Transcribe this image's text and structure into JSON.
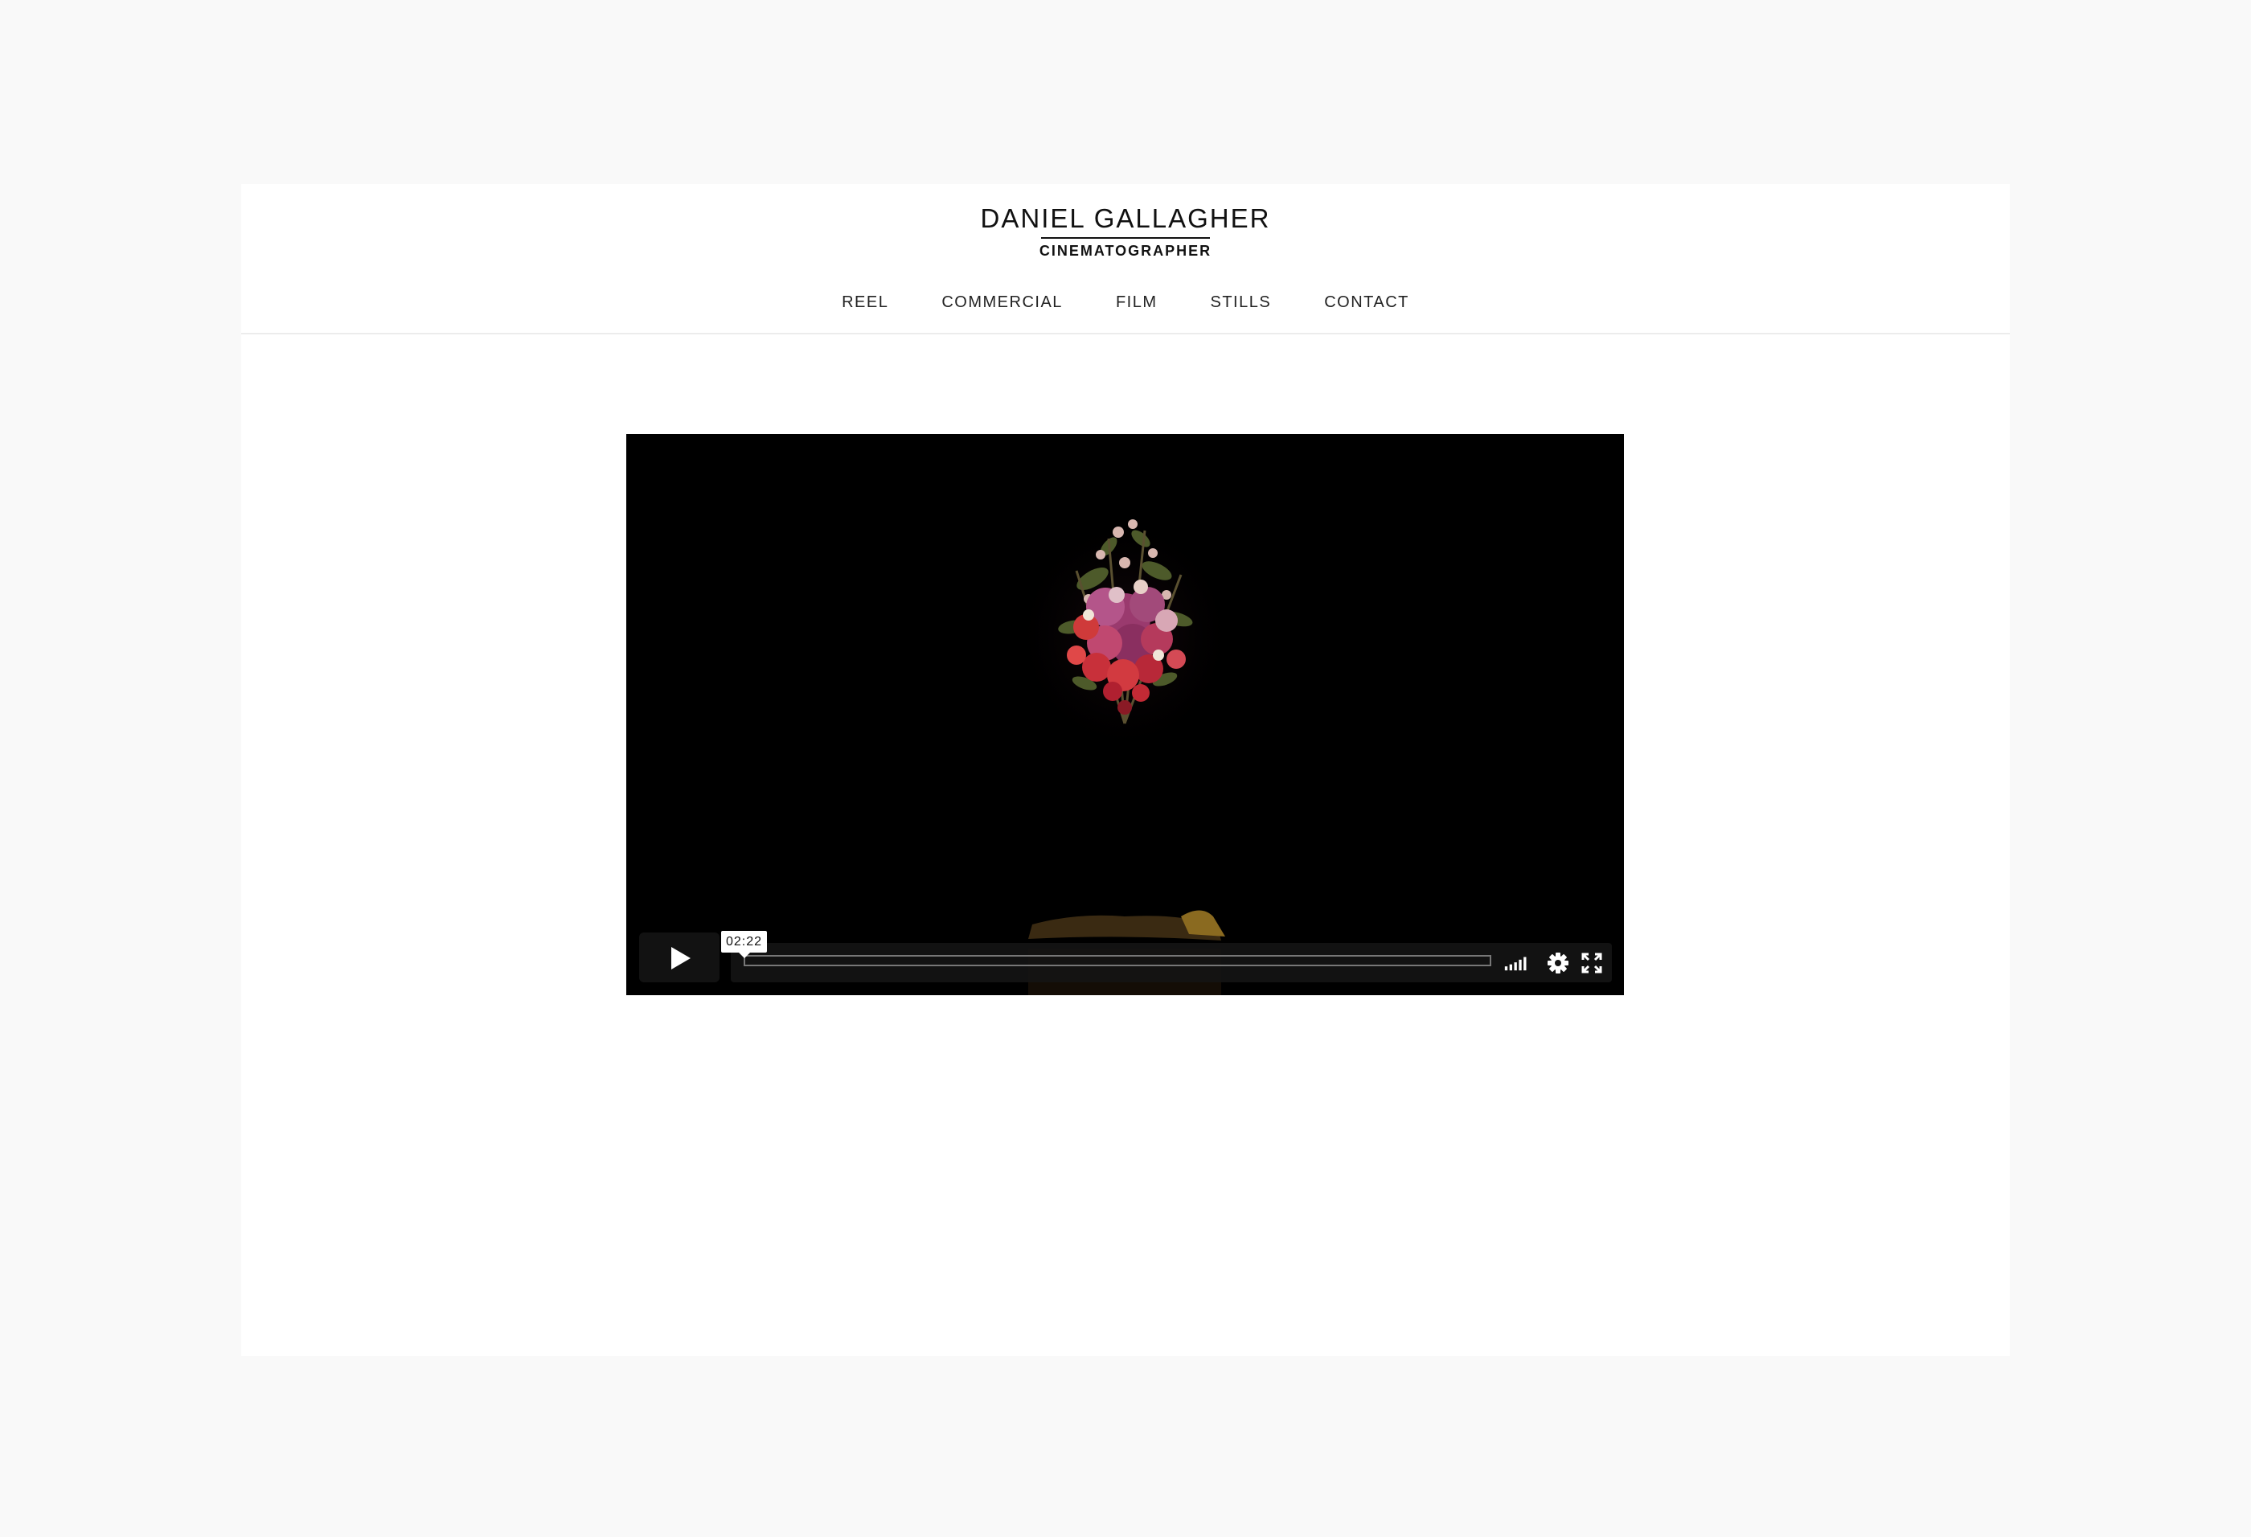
{
  "header": {
    "name": "DANIEL GALLAGHER",
    "subtitle": "CINEMATOGRAPHER"
  },
  "nav": {
    "items": [
      "REEL",
      "COMMERCIAL",
      "FILM",
      "STILLS",
      "CONTACT"
    ]
  },
  "video": {
    "timecode": "02:22",
    "progress": 0,
    "controls": {
      "play_icon": "play-icon",
      "volume_icon": "volume-icon",
      "settings_icon": "gear-icon",
      "fullscreen_icon": "fullscreen-icon"
    }
  },
  "colors": {
    "page_background": "#f9f9f9",
    "content_background": "#ffffff",
    "text": "#111111",
    "video_background": "#000000"
  }
}
